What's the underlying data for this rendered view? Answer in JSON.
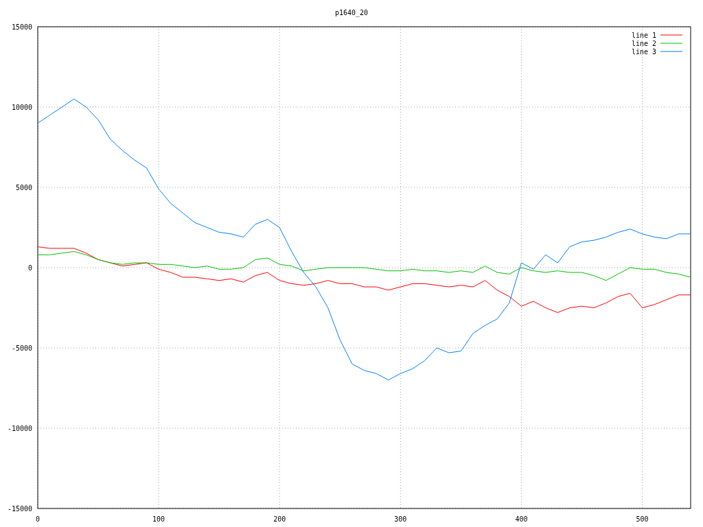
{
  "chart_data": {
    "type": "line",
    "title": "p1640_20",
    "x": [
      0,
      10,
      20,
      30,
      40,
      50,
      60,
      70,
      80,
      90,
      100,
      110,
      120,
      130,
      140,
      150,
      160,
      170,
      180,
      190,
      200,
      210,
      220,
      230,
      240,
      250,
      260,
      270,
      280,
      290,
      300,
      310,
      320,
      330,
      340,
      350,
      360,
      370,
      380,
      390,
      400,
      410,
      420,
      430,
      440,
      450,
      460,
      470,
      480,
      490,
      500,
      510,
      520,
      530,
      540
    ],
    "series": [
      {
        "name": "line 1",
        "color": "#ff0000",
        "values": [
          1300,
          1200,
          1200,
          1200,
          900,
          500,
          300,
          100,
          200,
          300,
          -100,
          -300,
          -600,
          -600,
          -700,
          -800,
          -700,
          -900,
          -500,
          -300,
          -800,
          -1000,
          -1100,
          -1000,
          -800,
          -1000,
          -1000,
          -1200,
          -1200,
          -1400,
          -1200,
          -1000,
          -1000,
          -1100,
          -1200,
          -1100,
          -1200,
          -800,
          -1400,
          -1800,
          -2400,
          -2100,
          -2500,
          -2800,
          -2500,
          -2400,
          -2500,
          -2200,
          -1800,
          -1600,
          -2500,
          -2300,
          -2000,
          -1700,
          -1700
        ]
      },
      {
        "name": "line 2",
        "color": "#00c000",
        "values": [
          800,
          800,
          900,
          1000,
          800,
          500,
          300,
          200,
          300,
          300,
          200,
          200,
          100,
          0,
          100,
          -100,
          -100,
          0,
          500,
          600,
          200,
          100,
          -200,
          -100,
          0,
          0,
          0,
          0,
          -100,
          -200,
          -200,
          -100,
          -200,
          -200,
          -300,
          -200,
          -300,
          100,
          -300,
          -400,
          0,
          -200,
          -300,
          -200,
          -300,
          -300,
          -500,
          -800,
          -400,
          0,
          -100,
          -100,
          -300,
          -400,
          -600
        ]
      },
      {
        "name": "line 3",
        "color": "#0080ff",
        "values": [
          9000,
          9500,
          10000,
          10500,
          10000,
          9200,
          8000,
          7300,
          6700,
          6200,
          4900,
          4000,
          3400,
          2800,
          2500,
          2200,
          2100,
          1900,
          2700,
          3000,
          2500,
          1000,
          -300,
          -1200,
          -2500,
          -4500,
          -6000,
          -6400,
          -6600,
          -7000,
          -6600,
          -6300,
          -5800,
          -5000,
          -5300,
          -5200,
          -4100,
          -3600,
          -3200,
          -2200,
          300,
          -100,
          800,
          300,
          1300,
          1600,
          1700,
          1900,
          2200,
          2400,
          2100,
          1900,
          1800,
          2100,
          2100
        ]
      }
    ],
    "grid": true,
    "legend": true,
    "xlim": [
      0,
      540
    ],
    "ylim": [
      -15000,
      15000
    ],
    "xticks": [
      0,
      100,
      200,
      300,
      400,
      500
    ],
    "yticks": [
      -15000,
      -10000,
      -5000,
      0,
      5000,
      10000,
      15000
    ]
  }
}
